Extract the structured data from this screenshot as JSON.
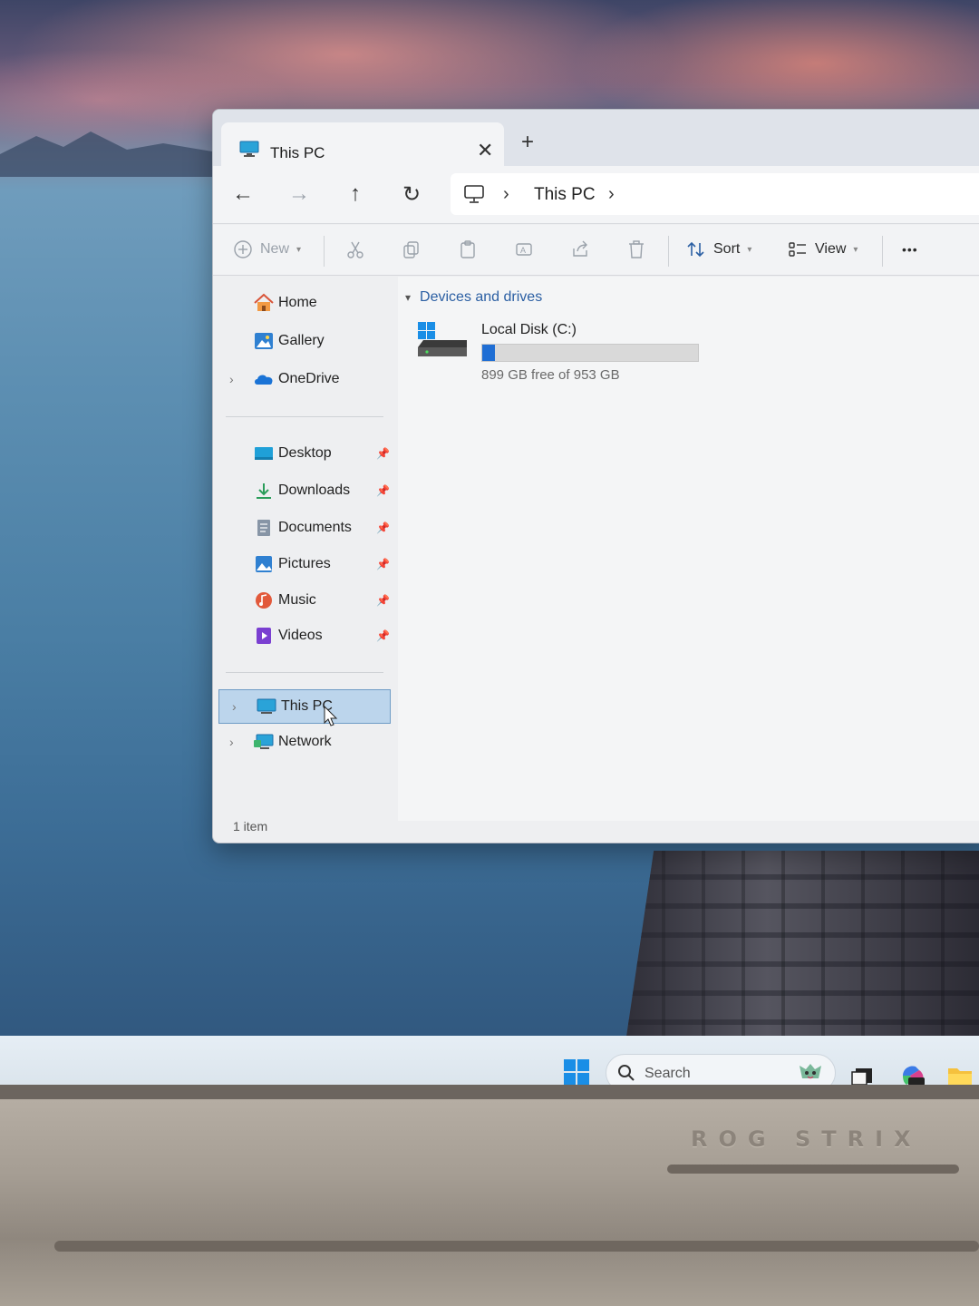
{
  "window": {
    "tab_title": "This PC",
    "tab_close": "✕",
    "tab_new": "+"
  },
  "navigation": {
    "back": "←",
    "forward": "→",
    "up": "↑",
    "refresh": "↻",
    "breadcrumb": [
      "This PC"
    ],
    "chevron": "›"
  },
  "toolbar": {
    "new_label": "New",
    "sort_label": "Sort",
    "view_label": "View",
    "more_label": "•••"
  },
  "sidebar": {
    "items": [
      {
        "label": "Home",
        "icon": "home-icon"
      },
      {
        "label": "Gallery",
        "icon": "gallery-icon"
      },
      {
        "label": "OneDrive",
        "icon": "onedrive-icon",
        "expandable": true
      }
    ],
    "quick_access": [
      {
        "label": "Desktop",
        "icon": "desktop-folder-icon",
        "pinned": true
      },
      {
        "label": "Downloads",
        "icon": "downloads-icon",
        "pinned": true
      },
      {
        "label": "Documents",
        "icon": "documents-icon",
        "pinned": true
      },
      {
        "label": "Pictures",
        "icon": "pictures-icon",
        "pinned": true
      },
      {
        "label": "Music",
        "icon": "music-icon",
        "pinned": true
      },
      {
        "label": "Videos",
        "icon": "videos-icon",
        "pinned": true
      }
    ],
    "locations": [
      {
        "label": "This PC",
        "icon": "pc-icon",
        "selected": true
      },
      {
        "label": "Network",
        "icon": "network-icon"
      }
    ]
  },
  "main": {
    "group_header": "Devices and drives",
    "drives": [
      {
        "name": "Local Disk (C:)",
        "free_text": "899 GB free of 953 GB",
        "used_fraction": 0.057
      }
    ]
  },
  "status_bar": {
    "item_count": "1 item"
  },
  "taskbar": {
    "search_placeholder": "Search"
  },
  "laptop": {
    "brand": "ROG STRIX"
  },
  "colors": {
    "accent": "#1f6ed4",
    "selection_bg": "#bcd5ec",
    "group_header": "#2b5fa3"
  }
}
